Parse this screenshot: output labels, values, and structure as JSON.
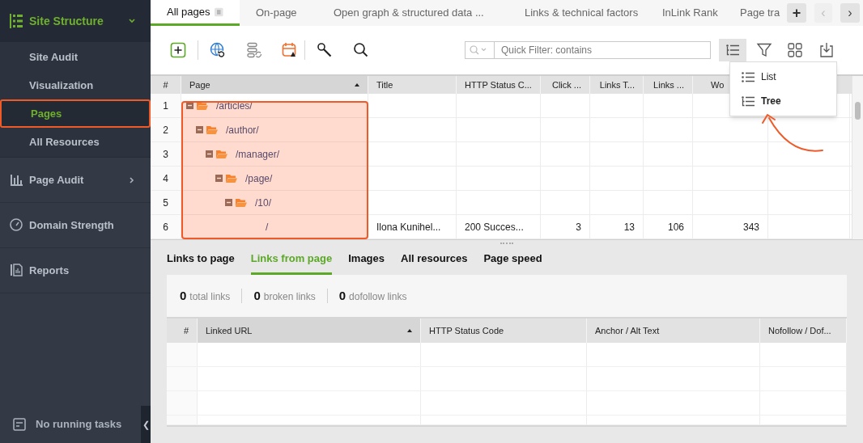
{
  "sidebar": {
    "header": {
      "label": "Site Structure",
      "expanded": true
    },
    "sub_items": [
      {
        "label": "Site Audit",
        "selected": false
      },
      {
        "label": "Visualization",
        "selected": false
      },
      {
        "label": "Pages",
        "selected": true
      },
      {
        "label": "All Resources",
        "selected": false
      }
    ],
    "sections": [
      {
        "label": "Page Audit",
        "kind": "audit",
        "expanded": false
      },
      {
        "label": "Domain Strength",
        "kind": "gauge"
      },
      {
        "label": "Reports",
        "kind": "report"
      }
    ],
    "tasks": "No running tasks",
    "collapse": "❮"
  },
  "tabs": [
    {
      "label": "All pages",
      "selected": true
    },
    {
      "label": "On-page",
      "selected": false
    },
    {
      "label": "Open graph & structured data ...",
      "selected": false
    },
    {
      "label": "Links & technical factors",
      "selected": false
    },
    {
      "label": "InLink Rank",
      "selected": false
    },
    {
      "label": "Page tra",
      "selected": false
    }
  ],
  "tab_controls": {
    "add": "+",
    "prev": "‹",
    "next": "›"
  },
  "search": {
    "placeholder": "Quick Filter: contains"
  },
  "view_menu": {
    "items": [
      {
        "label": "List",
        "selected": false
      },
      {
        "label": "Tree",
        "selected": true
      }
    ]
  },
  "grid": {
    "columns": [
      "#",
      "Page",
      "Title",
      "HTTP Status C...",
      "Click ...",
      "Links T...",
      "Links ...",
      "Wo"
    ],
    "rows": [
      {
        "num": "1",
        "page": "/articles/",
        "expanded": true,
        "children": [
          {
            "num": "2",
            "page": "/author/",
            "expanded": true,
            "children": [
              {
                "num": "3",
                "page": "/manager/",
                "expanded": true,
                "children": [
                  {
                    "num": "4",
                    "page": "/page/",
                    "expanded": true,
                    "children": [
                      {
                        "num": "5",
                        "page": "/10/",
                        "expanded": true,
                        "children": [
                          {
                            "num": "6",
                            "page": "/",
                            "cells": [
                              "Ilona Kunihel...",
                              "200 Succes...",
                              "3",
                              "13",
                              "106",
                              "343"
                            ]
                          }
                        ]
                      }
                    ]
                  }
                ]
              }
            ]
          }
        ]
      }
    ]
  },
  "bottom_tabs": [
    {
      "label": "Links to page",
      "selected": false
    },
    {
      "label": "Links from page",
      "selected": true
    },
    {
      "label": "Images",
      "selected": false
    },
    {
      "label": "All resources",
      "selected": false
    },
    {
      "label": "Page speed",
      "selected": false
    }
  ],
  "summary": [
    {
      "count": "0",
      "label": "total links"
    },
    {
      "count": "0",
      "label": "broken links"
    },
    {
      "count": "0",
      "label": "dofollow links"
    }
  ],
  "links_table": {
    "columns": [
      "#",
      "Linked URL",
      "HTTP Status Code",
      "Anchor / Alt Text",
      "Nofollow / Dof..."
    ]
  }
}
